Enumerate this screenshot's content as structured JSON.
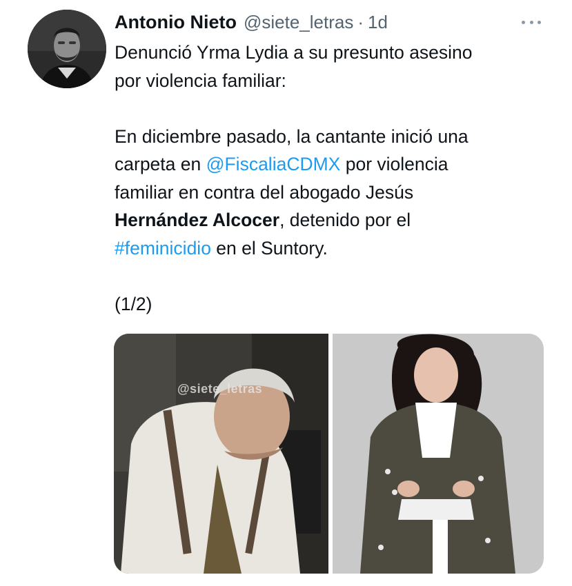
{
  "tweet": {
    "author_name": "Antonio Nieto",
    "handle": "@siete_letras",
    "separator": "·",
    "time": "1d",
    "text": {
      "line1": "Denunció Yrma Lydia a su presunto asesino",
      "line2": "por violencia familiar:",
      "p2_a": "En diciembre pasado, la cantante inició una",
      "p2_b": "carpeta en ",
      "mention": "@FiscaliaCDMX",
      "p2_c": " por violencia",
      "p2_d": "familiar en contra del abogado Jesús",
      "p2_bold": "Hernández Alcocer",
      "p2_e": ", detenido por el",
      "hashtag": "#feminicidio",
      "p2_f": " en el Suntory.",
      "counter": "(1/2)"
    },
    "media": {
      "watermark": "@siete_letras"
    }
  },
  "colors": {
    "link": "#1d9bf0",
    "muted": "#536471",
    "text": "#0f1419"
  },
  "icons": {
    "more": "more-horizontal-icon"
  }
}
